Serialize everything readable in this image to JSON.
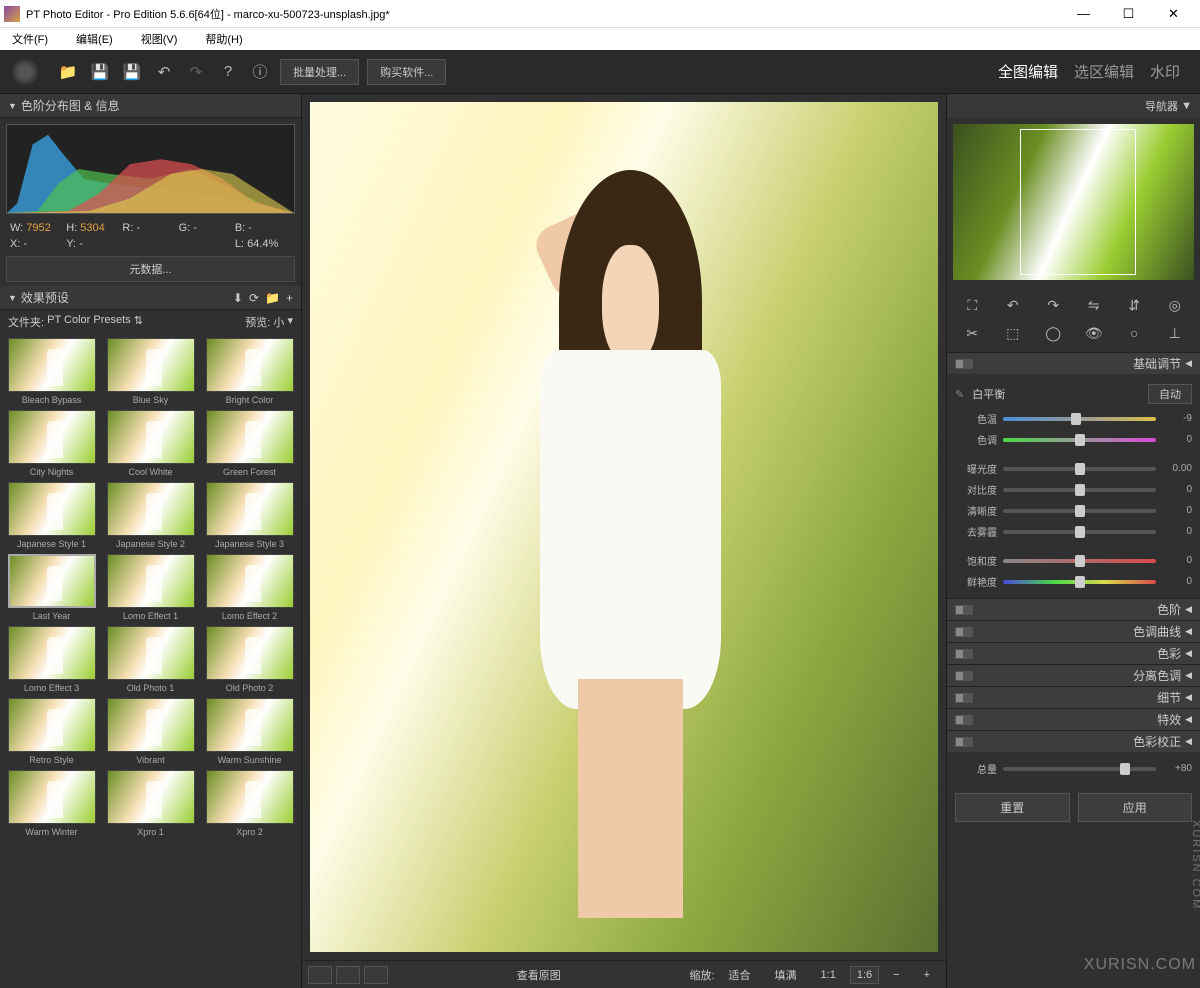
{
  "window": {
    "title": "PT Photo Editor - Pro Edition 5.6.6[64位] - marco-xu-500723-unsplash.jpg*",
    "min": "—",
    "max": "☐",
    "close": "✕"
  },
  "menu": {
    "file": "文件(F)",
    "edit": "编辑(E)",
    "view": "视图(V)",
    "help": "帮助(H)"
  },
  "toolbar": {
    "batch": "批量处理...",
    "buy": "购买软件..."
  },
  "modes": {
    "full": "全图编辑",
    "region": "选区编辑",
    "watermark": "水印"
  },
  "histogram": {
    "title": "色阶分布图 & 信息",
    "w_lbl": "W:",
    "w": "7952",
    "h_lbl": "H:",
    "h": "5304",
    "r_lbl": "R:",
    "r": "-",
    "g_lbl": "G:",
    "g": "-",
    "b_lbl": "B:",
    "b": "-",
    "x_lbl": "X:",
    "x": "-",
    "y_lbl": "Y:",
    "y": "-",
    "l_lbl": "L:",
    "l": "64.4%",
    "meta": "元数据..."
  },
  "presets": {
    "title": "效果预设",
    "folder_lbl": "文件夹:",
    "folder": "PT Color Presets",
    "preview_lbl": "预览:",
    "preview": "小",
    "items": [
      "Bleach Bypass",
      "Blue Sky",
      "Bright Color",
      "City Nights",
      "Cool White",
      "Green Forest",
      "Japanese Style 1",
      "Japanese Style 2",
      "Japanese Style 3",
      "Last Year",
      "Lomo Effect 1",
      "Lomo Effect 2",
      "Lomo Effect 3",
      "Old Photo 1",
      "Old Photo 2",
      "Retro Style",
      "Vibrant",
      "Warm Sunshine",
      "Warm Winter",
      "Xpro 1",
      "Xpro 2"
    ],
    "selected": 9
  },
  "bottombar": {
    "vieworig": "查看原图",
    "zoom_lbl": "缩放:",
    "fit": "适合",
    "fill": "填满",
    "z11": "1:1",
    "z16": "1:6",
    "minus": "−",
    "plus": "+"
  },
  "navigator": {
    "title": "导航器"
  },
  "adjustpanels": {
    "basic": "基础调节",
    "levels": "色阶",
    "curves": "色调曲线",
    "color": "色彩",
    "split": "分离色调",
    "detail": "细节",
    "effects": "特效",
    "calib": "色彩校正"
  },
  "whitebalance": {
    "label": "白平衡",
    "auto": "自动"
  },
  "sliders": {
    "temp": {
      "label": "色温",
      "value": "-9",
      "pos": 48
    },
    "tint": {
      "label": "色调",
      "value": "0",
      "pos": 50
    },
    "exposure": {
      "label": "曝光度",
      "value": "0.00",
      "pos": 50
    },
    "contrast": {
      "label": "对比度",
      "value": "0",
      "pos": 50
    },
    "clarity": {
      "label": "清晰度",
      "value": "0",
      "pos": 50
    },
    "dehaze": {
      "label": "去雾霾",
      "value": "0",
      "pos": 50
    },
    "saturation": {
      "label": "饱和度",
      "value": "0",
      "pos": 50
    },
    "vibrance": {
      "label": "鲜艳度",
      "value": "0",
      "pos": 50
    },
    "amount": {
      "label": "总量",
      "value": "+80",
      "pos": 80
    }
  },
  "buttons": {
    "reset": "重置",
    "apply": "应用"
  },
  "watermark_text": "XURISN.COM"
}
